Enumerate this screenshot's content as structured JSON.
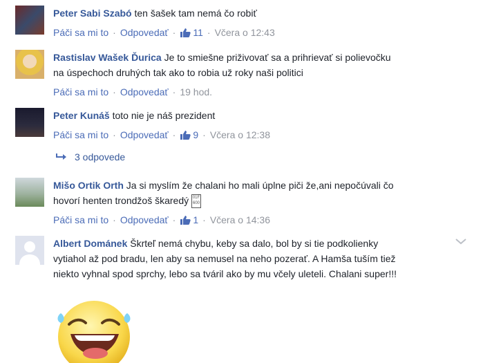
{
  "comments": [
    {
      "author": "Peter Sabi Szabó",
      "text": "ten šašek tam nemá čo robiť",
      "like_label": "Páči sa mi to",
      "reply_label": "Odpovedať",
      "likes": "11",
      "time": "Včera o 12:43"
    },
    {
      "author": "Rastislav Wašek Ďurica",
      "text_line1": "Je to smiešne priživovať sa a prihrievať si polievočku",
      "text_line2": "na úspechoch druhých tak ako to robia už roky naši politici",
      "like_label": "Páči sa mi to",
      "reply_label": "Odpovedať",
      "time": "19 hod."
    },
    {
      "author": "Peter Kunáš",
      "text": "toto nie je náš prezident",
      "like_label": "Páči sa mi to",
      "reply_label": "Odpovedať",
      "likes": "9",
      "time": "Včera o 12:38"
    },
    {
      "author": "Mišo Ortik Orth",
      "text_line1": "Ja si myslím že chalani ho mali úplne piči že,ani nepočúvali čo",
      "text_line2": "hovorí henten trondžoš škaredý",
      "like_label": "Páči sa mi to",
      "reply_label": "Odpovedať",
      "likes": "1",
      "time": "Včera o 14:36"
    },
    {
      "author": "Albert Dománek",
      "text_line1": "Škrteľ nemá chybu, keby sa dalo, bol by si tie podkolienky",
      "text_line2": "vytiahol až pod bradu, len aby sa nemusel na neho pozerať. A Hamša tuším tiež",
      "text_line3": "niekto vyhnal spod sprchy, lebo sa tváril ako by mu včely uleteli. Chalani super!!!"
    }
  ],
  "replies_link": "3 odpovede",
  "icons": {
    "thumb": "thumbs-up-icon",
    "reply_arrow": "reply-arrow-icon",
    "chevron": "chevron-down-icon",
    "emoji": "laughing-tears-emoji-icon"
  },
  "colors": {
    "author": "#365899",
    "link": "#4b6cb7",
    "meta": "#90949c"
  }
}
